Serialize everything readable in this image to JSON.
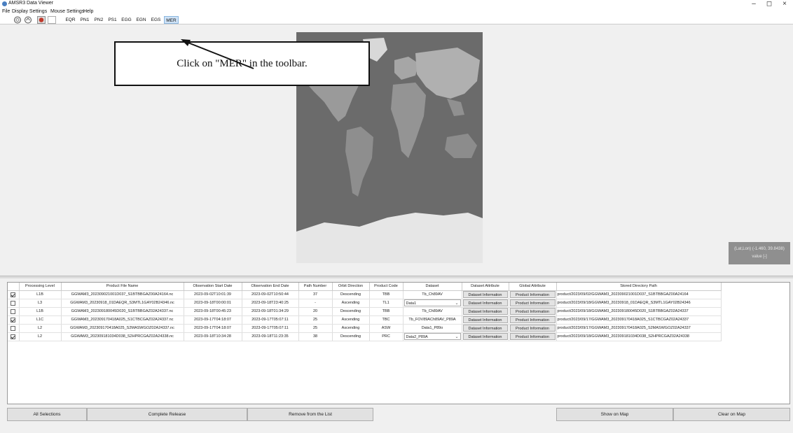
{
  "window": {
    "title": "AMSR3 Data Viewer",
    "minimize": "–",
    "maximize": "◻",
    "close": "×"
  },
  "menu": {
    "items": [
      "File",
      "Display Settings",
      "Mouse Settings",
      "Help"
    ]
  },
  "toolbar": {
    "projections": [
      "EQR",
      "PN1",
      "PN2",
      "PS1",
      "EGG",
      "EGN",
      "EGS",
      "MER"
    ],
    "active": "MER"
  },
  "callout": {
    "text": "Click on \"MER\" in the toolbar."
  },
  "map": {
    "coord_text": "(Lat,Lon) (-1.460, 39.8438)",
    "value_text": "value [-]"
  },
  "table": {
    "headers": [
      "",
      "Processing Level",
      "Product File Name",
      "Observation Start Date",
      "Observation End Date",
      "Path Number",
      "Orbit Direction",
      "Product Code",
      "Dataset",
      "Dataset Attribute",
      "Global Attribute",
      "Stored Directory Path"
    ],
    "dataset_info_label": "Dataset Information",
    "product_info_label": "Product Information",
    "rows": [
      {
        "checked": true,
        "level": "L1B",
        "file": "GGWAM3_202309021001D037_S1BTBBGAZ00A24164.nc",
        "start": "2023-09-02T10:01:39",
        "end": "2023-09-02T10:50:44",
        "path": "37",
        "orbit": "Descending",
        "code": "TBB",
        "dataset": "Tb_Ch89AV",
        "dataset_select": false,
        "dir": "product/2023/09/02/GGWAM3_202309021001D037_S1BTBBGAZ00A24164"
      },
      {
        "checked": false,
        "level": "L3",
        "file": "GGWAM3_20230918_01DAEQR_S3MTL1GAY02B24346.nc",
        "start": "2023-09-18T00:00:01",
        "end": "2023-09-18T23:40:25",
        "path": "-",
        "orbit": "Ascending",
        "code": "TL1",
        "dataset": "Data1",
        "dataset_select": true,
        "dir": "product/2023/09/18/GGWAM3_20230918_01DAEQR_S3MTL1GAY02B24346"
      },
      {
        "checked": false,
        "level": "L1B",
        "file": "GGWAM3_202309180045D020_S1BTBBGAZ02A24337.nc",
        "start": "2023-09-18T00:45:23",
        "end": "2023-09-18T01:34:29",
        "path": "20",
        "orbit": "Descending",
        "code": "TBB",
        "dataset": "Tb_Ch89AV",
        "dataset_select": false,
        "dir": "product/2023/09/18/GGWAM3_202309180045D020_S1BTBBGAZ02A24337"
      },
      {
        "checked": true,
        "level": "L1C",
        "file": "GGWAM3_202309170418A025_S1CTBCGAZ02A24337.nc",
        "start": "2023-09-17T04:18:07",
        "end": "2023-09-17T05:07:11",
        "path": "25",
        "orbit": "Ascending",
        "code": "TBC",
        "dataset": "Tb_FOV89ACh89AV_P89A",
        "dataset_select": false,
        "dir": "product/2023/09/17/GGWAM3_202309170418A025_S1CTBCGAZ02A24337"
      },
      {
        "checked": false,
        "level": "L2",
        "file": "GGWAM3_202309170418A025_S2MASWGOZ02A24337.nc",
        "start": "2023-09-17T04:18:07",
        "end": "2023-09-17T05:07:11",
        "path": "25",
        "orbit": "Ascending",
        "code": "ASW",
        "dataset": "Data1_P89o",
        "dataset_select": false,
        "dir": "product/2023/09/17/GGWAM3_202309170418A025_S2MASWGOZ02A24337"
      },
      {
        "checked": true,
        "level": "L2",
        "file": "GGWAM3_202309181034D038_S2HPRCGAZ02A24338.nc",
        "start": "2023-09-18T10:34:28",
        "end": "2023-09-18T11:23:35",
        "path": "38",
        "orbit": "Descending",
        "code": "PRC",
        "dataset": "Data2_P89A",
        "dataset_select": true,
        "dir": "product/2023/09/18/GGWAM3_202309181034D038_S2HPRCGAZ02A24338"
      }
    ]
  },
  "bottom": {
    "all_selections": "All Selections",
    "complete_release": "Complete Release",
    "remove": "Remove from the List",
    "show_on_map": "Show on Map",
    "clear_on_map": "Clear on Map"
  }
}
